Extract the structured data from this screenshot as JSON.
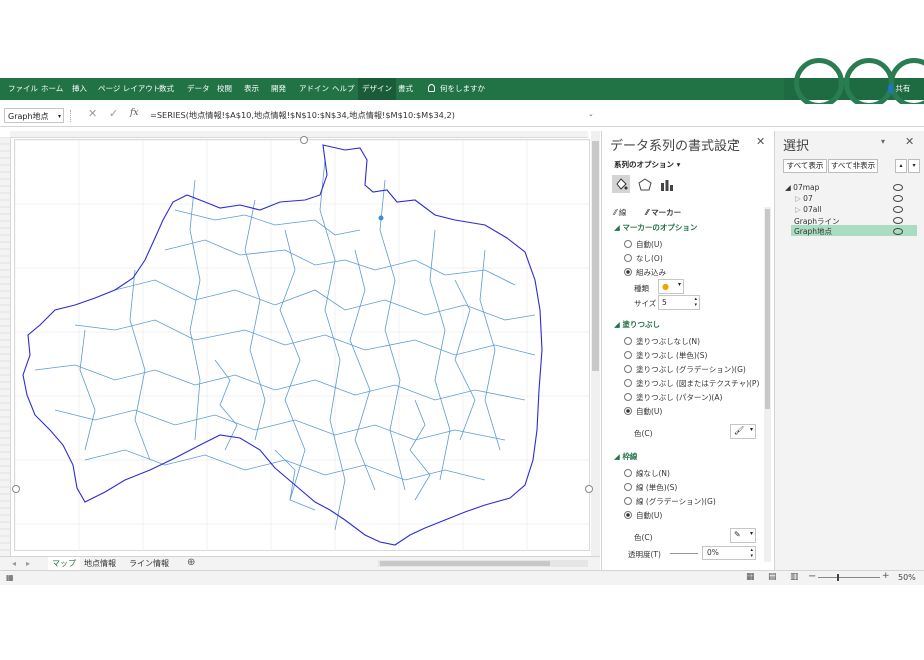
{
  "ribbon": {
    "tabs": [
      "ファイル",
      "ホーム",
      "挿入",
      "ページ レイアウト",
      "数式",
      "データ",
      "校閲",
      "表示",
      "開発",
      "アドイン",
      "ヘルプ",
      "デザイン",
      "書式"
    ],
    "tell_me": "何をしますか",
    "share": "共有"
  },
  "formula_bar": {
    "name_box": "Graph地点",
    "fx": "fx",
    "formula": "=SERIES(地点情報!$A$10,地点情報!$N$10:$N$34,地点情報!$M$10:$M$34,2)"
  },
  "sheet_tabs": [
    "マップ",
    "地点情報",
    "ライン情報"
  ],
  "format_pane": {
    "title": "データ系列の書式設定",
    "options_label": "系列のオプション",
    "subtabs": [
      "線",
      "マーカー"
    ],
    "marker_options": "マーカーのオプション",
    "marker_radios": [
      "自動(U)",
      "なし(O)",
      "組み込み"
    ],
    "type_label": "種類",
    "size_label": "サイズ",
    "size_value": "5",
    "fill_section": "塗りつぶし",
    "fill_radios": [
      "塗りつぶしなし(N)",
      "塗りつぶし (単色)(S)",
      "塗りつぶし (グラデーション)(G)",
      "塗りつぶし (図またはテクスチャ)(P)",
      "塗りつぶし (パターン)(A)",
      "自動(U)"
    ],
    "color_label": "色(C)",
    "border_section": "枠線",
    "border_radios": [
      "線なし(N)",
      "線 (単色)(S)",
      "線 (グラデーション)(G)",
      "自動(U)"
    ],
    "border_color_label": "色(C)",
    "transparency_label": "透明度(T)",
    "transparency_value": "0%"
  },
  "selection_pane": {
    "title": "選択",
    "show_all": "すべて表示",
    "hide_all": "すべて非表示",
    "items": [
      "07map",
      "07",
      "07all",
      "Graphライン",
      "Graph地点"
    ]
  },
  "status_bar": {
    "zoom": "50%"
  },
  "colors": {
    "accent": "#217346",
    "border_line": "#2b2bd6",
    "river": "#5b9bd5",
    "marker": "#3b8fd8",
    "selected": "#a9dcc0"
  }
}
